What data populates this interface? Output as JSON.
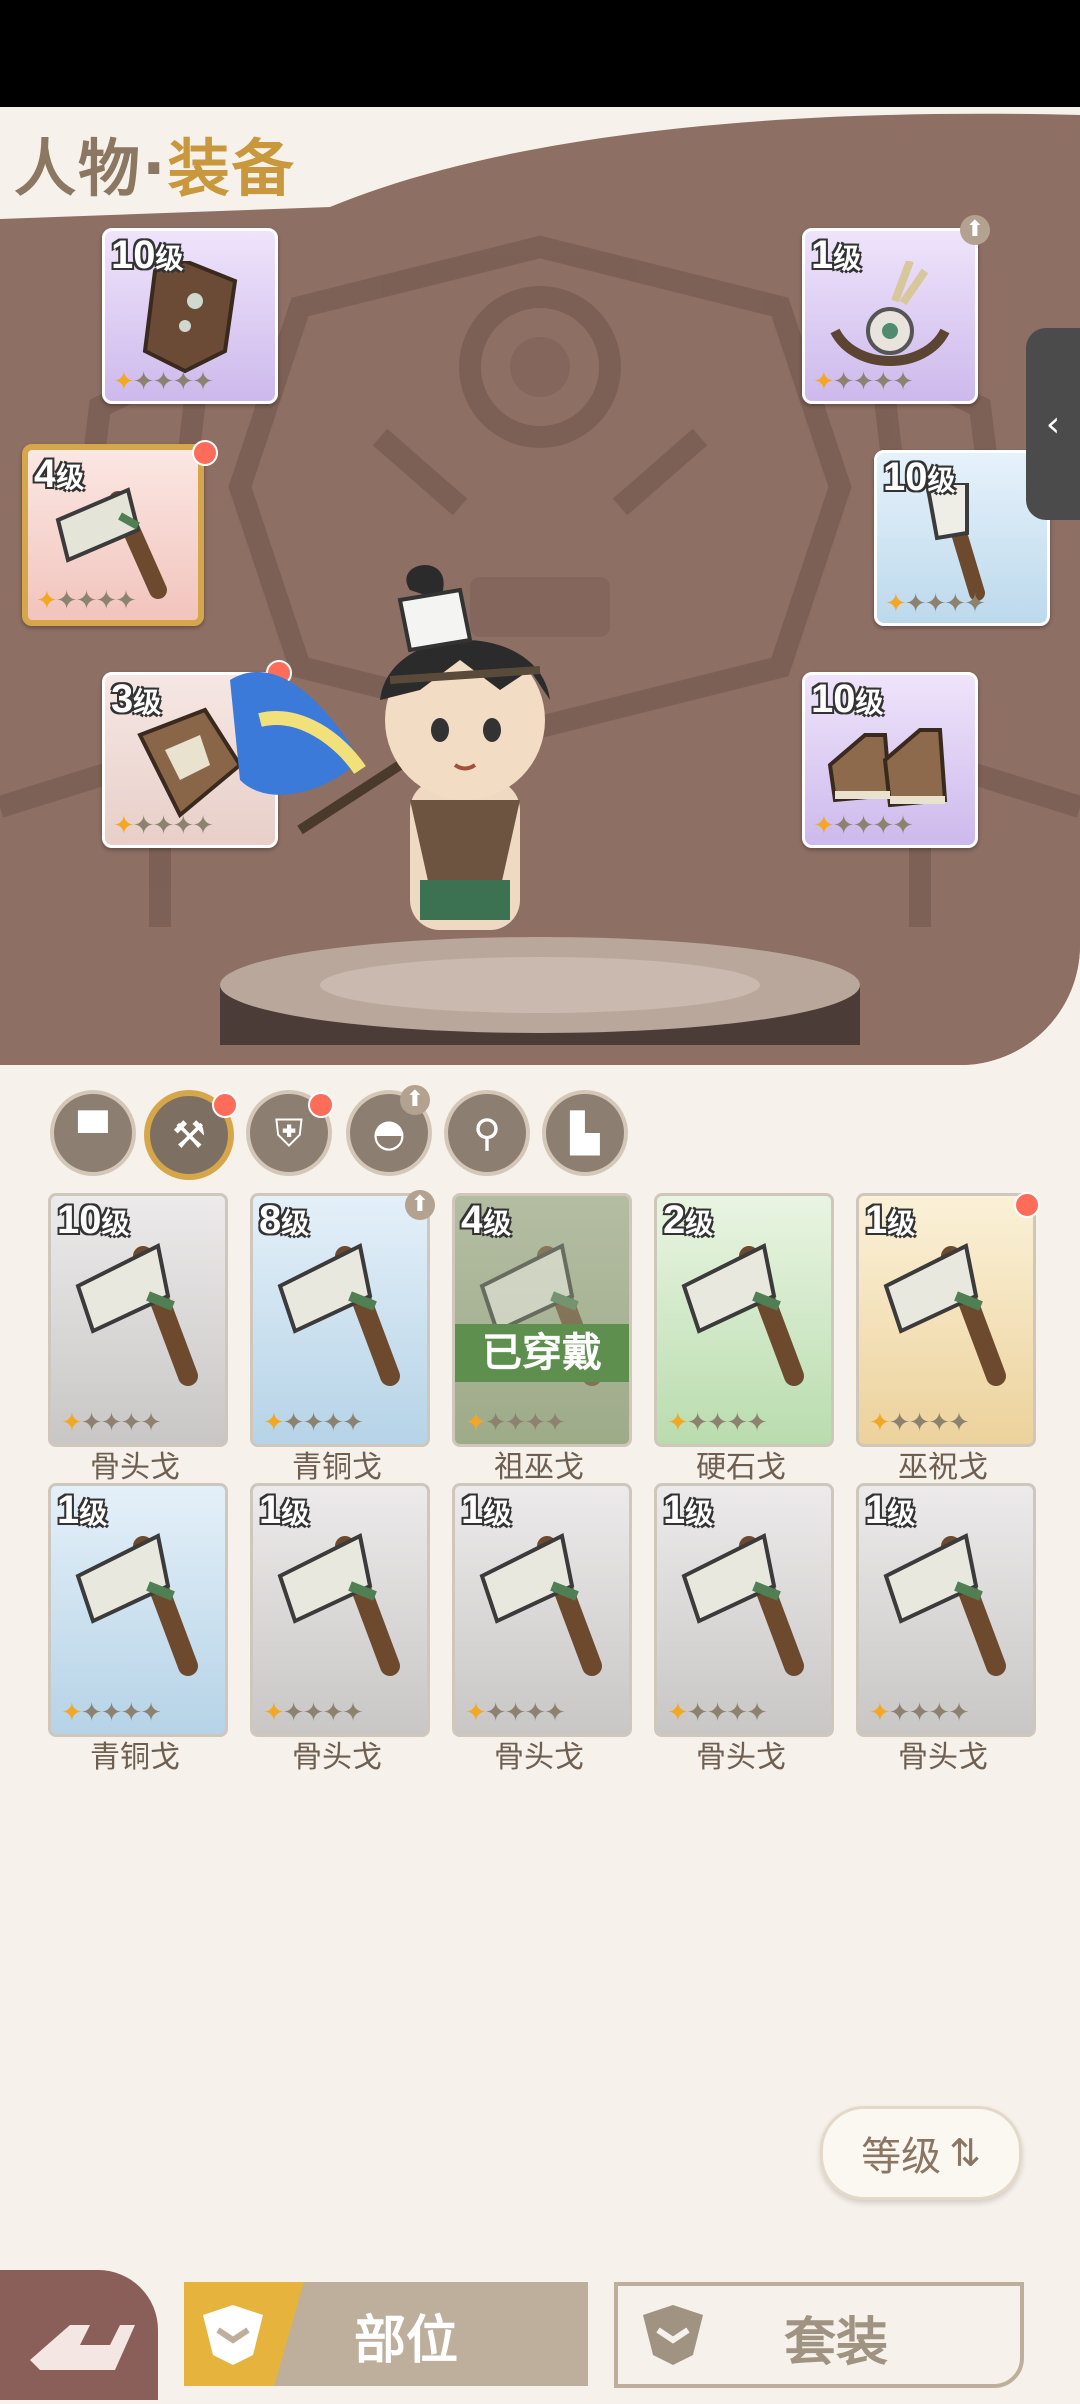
{
  "header": {
    "title_part1": "人物·",
    "title_part2": "装备"
  },
  "equipped_slots": [
    {
      "level": "10",
      "unit": "级",
      "stars": 1,
      "icon": "armor-vest-icon"
    },
    {
      "level": "1",
      "unit": "级",
      "stars": 1,
      "icon": "necklace-icon",
      "upgrade": true
    },
    {
      "level": "4",
      "unit": "级",
      "stars": 1,
      "icon": "stone-axe-icon",
      "dot": true,
      "selected": true
    },
    {
      "level": "10",
      "unit": "级",
      "stars": 1,
      "icon": "bone-club-icon"
    },
    {
      "level": "3",
      "unit": "级",
      "stars": 1,
      "icon": "shield-icon",
      "dot": true
    },
    {
      "level": "10",
      "unit": "级",
      "stars": 1,
      "icon": "boots-icon"
    }
  ],
  "categories": [
    {
      "icon": "armor-icon"
    },
    {
      "icon": "weapon-icon",
      "active": true,
      "dot": true
    },
    {
      "icon": "shield-icon",
      "dot": true
    },
    {
      "icon": "helmet-icon",
      "upgrade": true
    },
    {
      "icon": "necklace-icon"
    },
    {
      "icon": "boots-icon"
    }
  ],
  "inventory": [
    {
      "level": "10",
      "unit": "级",
      "name": "骨头戈",
      "rarity": "grey",
      "stars": 1
    },
    {
      "level": "8",
      "unit": "级",
      "name": "青铜戈",
      "rarity": "blue",
      "stars": 1,
      "upgrade": true
    },
    {
      "level": "4",
      "unit": "级",
      "name": "祖巫戈",
      "rarity": "equipped",
      "stars": 1,
      "badge": "已穿戴"
    },
    {
      "level": "2",
      "unit": "级",
      "name": "硬石戈",
      "rarity": "green",
      "stars": 1
    },
    {
      "level": "1",
      "unit": "级",
      "name": "巫祝戈",
      "rarity": "gold",
      "stars": 1,
      "dot": true
    },
    {
      "level": "1",
      "unit": "级",
      "name": "青铜戈",
      "rarity": "blue",
      "stars": 1
    },
    {
      "level": "1",
      "unit": "级",
      "name": "骨头戈",
      "rarity": "grey",
      "stars": 1
    },
    {
      "level": "1",
      "unit": "级",
      "name": "骨头戈",
      "rarity": "grey",
      "stars": 1
    },
    {
      "level": "1",
      "unit": "级",
      "name": "骨头戈",
      "rarity": "grey",
      "stars": 1
    },
    {
      "level": "1",
      "unit": "级",
      "name": "骨头戈",
      "rarity": "grey",
      "stars": 1
    }
  ],
  "sort": {
    "label": "等级"
  },
  "tabs": {
    "part": "部位",
    "set": "套装"
  }
}
